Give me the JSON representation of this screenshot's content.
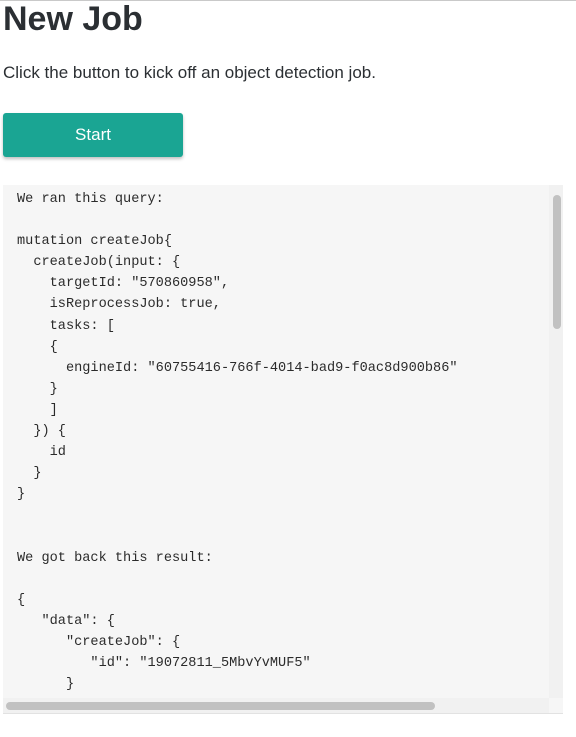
{
  "page": {
    "title": "New Job",
    "intro": "Click the button to kick off an object detection job."
  },
  "actions": {
    "start_label": "Start"
  },
  "output": {
    "query_heading": "We ran this query:",
    "query_lines": [
      "mutation createJob{",
      "  createJob(input: {",
      "    targetId: \"570860958\",",
      "    isReprocessJob: true,",
      "    tasks: [",
      "    {",
      "      engineId: \"60755416-766f-4014-bad9-f0ac8d900b86\"",
      "    }",
      "    ]",
      "  }) {",
      "    id",
      "  }",
      "}"
    ],
    "result_heading": "We got back this result:",
    "result_lines": [
      "{",
      "   \"data\": {",
      "      \"createJob\": {",
      "         \"id\": \"19072811_5MbvYvMUF5\"",
      "      }",
      "   }",
      "}"
    ]
  },
  "colors": {
    "accent": "#1aa593",
    "panel_background": "#f6f6f6",
    "text": "#2b2f33"
  }
}
